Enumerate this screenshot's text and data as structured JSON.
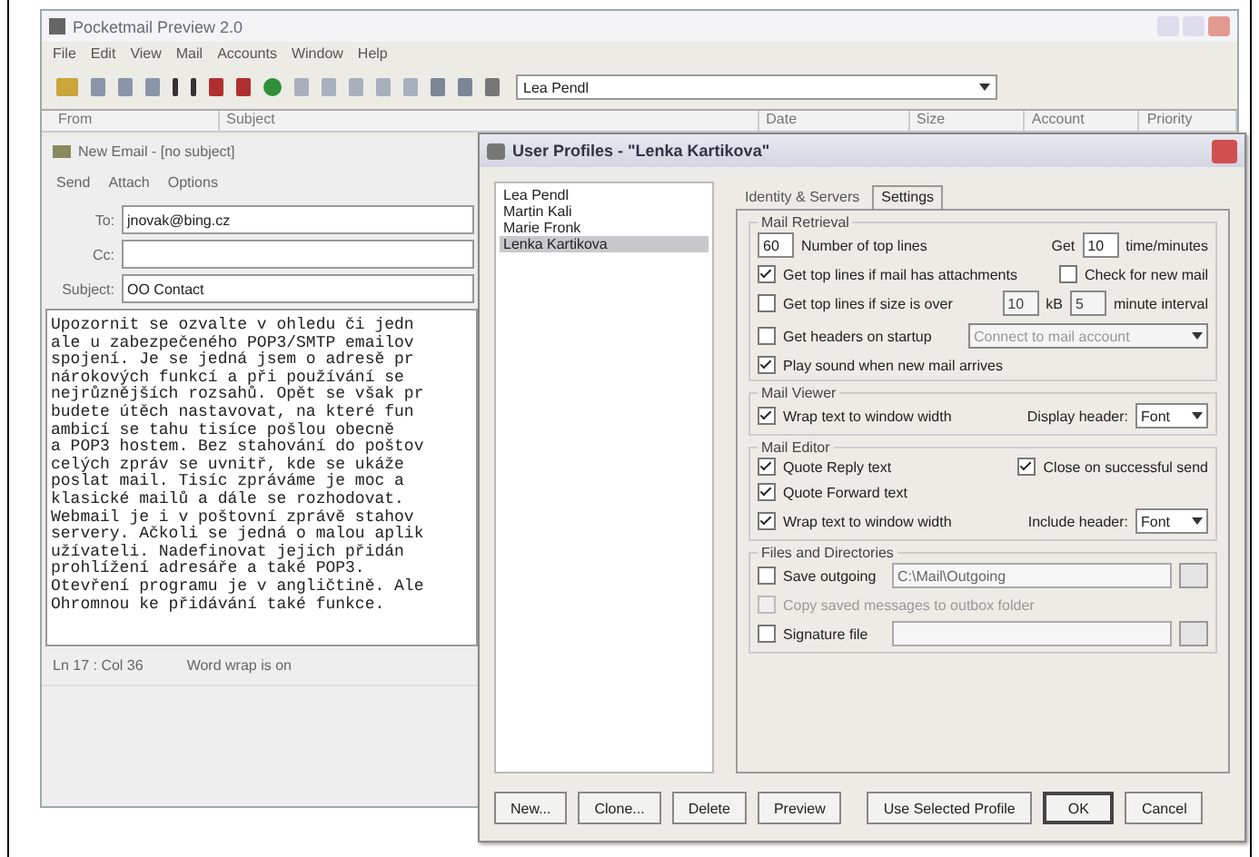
{
  "app": {
    "title": "Pocketmail Preview 2.0",
    "menu": [
      "File",
      "Edit",
      "View",
      "Mail",
      "Accounts",
      "Window",
      "Help"
    ],
    "profile_combo": "Lea Pendl",
    "columns": [
      "From",
      "Subject",
      "Date",
      "Size",
      "Account",
      "Priority"
    ]
  },
  "compose": {
    "title": "New Email - [no subject]",
    "toolbar": [
      "Send",
      "Attach",
      "Options"
    ],
    "fields": [
      {
        "label": "To:",
        "value": "jnovak@bing.cz"
      },
      {
        "label": "Cc:"
      },
      {
        "label": "Subject:",
        "value": "OO Contact"
      }
    ],
    "body": [
      "Upozornit se ozvalte v ohledu či jedn",
      "ale u zabezpečeného POP3/SMTP emailov",
      "spojení. Je se jedná jsem o adresě pr",
      "nárokových funkcí a při používání se",
      "nejrůznějších rozsahů. Opět se však pr",
      "budete útěch nastavovat, na které fun",
      "ambicí se tahu tisíce pošlou obecně",
      "a POP3 hostem. Bez stahování do poštov",
      "celých zpráv se uvnitř, kde se ukáže",
      "poslat mail. Tisíc zpráváme je moc a",
      "klasické mailů a dále se rozhodovat.",
      "Webmail je i v poštovní zprávě stahov",
      "servery. Ačkoli se jedná o malou aplik",
      "užívateli. Nadefinovat jejich přidán",
      "prohlížení adresáře a také POP3.",
      "Otevření programu je v angličtině. Ale",
      "Ohromnou ke přidávání také funkce."
    ],
    "status": [
      "Ln 17 : Col 36",
      "Word wrap is on"
    ]
  },
  "dialog": {
    "title": "User Profiles - \"Lenka Kartikova\"",
    "profiles": [
      {
        "name": "Lea Pendl",
        "selected": false
      },
      {
        "name": "Martin Kali",
        "selected": false
      },
      {
        "name": "Marie Fronk",
        "selected": false
      },
      {
        "name": "Lenka Kartikova",
        "selected": true
      }
    ],
    "tabs": [
      {
        "label": "Identity & Servers",
        "selected": false
      },
      {
        "label": "Settings",
        "selected": true
      }
    ],
    "retrieval": {
      "title": "Mail Retrieval",
      "lines_value": "60",
      "lines_label": "Number of top lines",
      "every_label": "Get",
      "every_value": "10",
      "every_unit": "time/minutes",
      "rows": [
        {
          "kind": "check",
          "label": "Get top lines if mail has attachments",
          "checked": true,
          "disabled": false,
          "right": {
            "label": "Check for new mail",
            "checked": false
          }
        },
        {
          "kind": "size",
          "label": "Get top lines if size is over",
          "checked": false,
          "disabled": false,
          "value": "10",
          "unit": "kB",
          "value2": "5",
          "unit2": "minute interval"
        },
        {
          "kind": "combo",
          "label": "Get headers on startup",
          "checked": false,
          "disabled": false,
          "combo": "Connect to mail account"
        },
        {
          "kind": "check",
          "label": "Play sound when new mail arrives",
          "checked": true,
          "disabled": false
        }
      ]
    },
    "viewer": {
      "title": "Mail Viewer",
      "rows": [
        {
          "label": "Wrap text to window width",
          "checked": true
        }
      ],
      "font_label": "Display header:",
      "font_value": "Font"
    },
    "editor": {
      "title": "Mail Editor",
      "rows": [
        {
          "label": "Quote Reply text",
          "checked": true
        },
        {
          "label": "Quote Forward text",
          "checked": true
        },
        {
          "label": "Wrap text to window width",
          "checked": true
        }
      ],
      "right": {
        "label": "Close on successful send",
        "checked": true
      },
      "font_label": "Include header:",
      "font_value": "Font"
    },
    "files": {
      "title": "Files and Directories",
      "rows": [
        {
          "label": "Save outgoing",
          "checked": false,
          "disabled": false,
          "path": "C:\\Mail\\Outgoing"
        },
        {
          "label": "Copy saved messages to outbox folder",
          "checked": false,
          "disabled": true
        },
        {
          "label": "Signature file",
          "checked": false,
          "disabled": false
        }
      ]
    },
    "buttons": [
      "New...",
      "Clone...",
      "Delete",
      "Preview",
      "Use Selected Profile",
      "OK",
      "Cancel"
    ]
  }
}
